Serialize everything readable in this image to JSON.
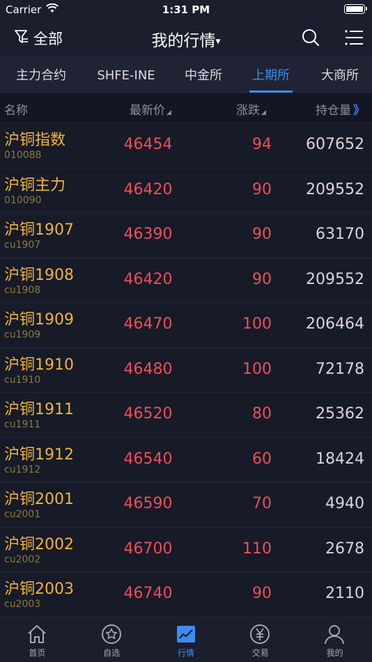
{
  "status_bar": {
    "carrier": "Carrier",
    "time": "1:31 PM"
  },
  "nav": {
    "filter_label": "全部",
    "title": "我的行情",
    "caret": "▾"
  },
  "tabs": [
    {
      "label": "主力合约"
    },
    {
      "label": "SHFE-INE"
    },
    {
      "label": "中金所"
    },
    {
      "label": "上期所"
    },
    {
      "label": "大商所"
    }
  ],
  "active_tab": "上期所",
  "columns": {
    "name": "名称",
    "price": "最新价",
    "change": "涨跌",
    "open_interest": "持仓量",
    "more_arrow": "》"
  },
  "rows": [
    {
      "name": "沪铜指数",
      "code": "010088",
      "price": "46454",
      "change": "94",
      "open_interest": "607652"
    },
    {
      "name": "沪铜主力",
      "code": "010090",
      "price": "46420",
      "change": "90",
      "open_interest": "209552"
    },
    {
      "name": "沪铜1907",
      "code": "cu1907",
      "price": "46390",
      "change": "90",
      "open_interest": "63170"
    },
    {
      "name": "沪铜1908",
      "code": "cu1908",
      "price": "46420",
      "change": "90",
      "open_interest": "209552"
    },
    {
      "name": "沪铜1909",
      "code": "cu1909",
      "price": "46470",
      "change": "100",
      "open_interest": "206464"
    },
    {
      "name": "沪铜1910",
      "code": "cu1910",
      "price": "46480",
      "change": "100",
      "open_interest": "72178"
    },
    {
      "name": "沪铜1911",
      "code": "cu1911",
      "price": "46520",
      "change": "80",
      "open_interest": "25362"
    },
    {
      "name": "沪铜1912",
      "code": "cu1912",
      "price": "46540",
      "change": "60",
      "open_interest": "18424"
    },
    {
      "name": "沪铜2001",
      "code": "cu2001",
      "price": "46590",
      "change": "70",
      "open_interest": "4940"
    },
    {
      "name": "沪铜2002",
      "code": "cu2002",
      "price": "46700",
      "change": "110",
      "open_interest": "2678"
    },
    {
      "name": "沪铜2003",
      "code": "cu2003",
      "price": "46740",
      "change": "90",
      "open_interest": "2110"
    }
  ],
  "tabbar": [
    {
      "label": "首页",
      "icon": "home-icon"
    },
    {
      "label": "自选",
      "icon": "star-icon"
    },
    {
      "label": "行情",
      "icon": "chart-icon"
    },
    {
      "label": "交易",
      "icon": "yen-icon"
    },
    {
      "label": "我的",
      "icon": "user-icon"
    }
  ],
  "colors": {
    "background": "#141623",
    "accent": "#3b8df0",
    "up_red": "#ef4e5a",
    "name_gold": "#f0b43c"
  }
}
